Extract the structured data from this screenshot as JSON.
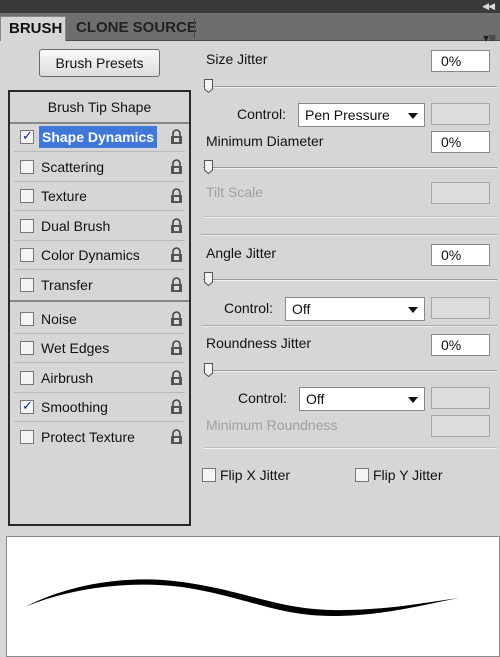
{
  "tabs": [
    {
      "label": "BRUSH"
    },
    {
      "label": "CLONE SOURCE"
    }
  ],
  "presets_button": "Brush Presets",
  "tip_shape_label": "Brush Tip Shape",
  "options": [
    {
      "label": "Shape Dynamics",
      "checked": true,
      "selected": true
    },
    {
      "label": "Scattering",
      "checked": false
    },
    {
      "label": "Texture",
      "checked": false
    },
    {
      "label": "Dual Brush",
      "checked": false
    },
    {
      "label": "Color Dynamics",
      "checked": false
    },
    {
      "label": "Transfer",
      "checked": false
    },
    {
      "label": "Noise",
      "checked": false
    },
    {
      "label": "Wet Edges",
      "checked": false
    },
    {
      "label": "Airbrush",
      "checked": false
    },
    {
      "label": "Smoothing",
      "checked": true
    },
    {
      "label": "Protect Texture",
      "checked": false
    }
  ],
  "settings": {
    "size_jitter": {
      "label": "Size Jitter",
      "value": "0%"
    },
    "size_control": {
      "label": "Control:",
      "value": "Pen Pressure"
    },
    "min_diameter": {
      "label": "Minimum Diameter",
      "value": "0%"
    },
    "tilt_scale": {
      "label": "Tilt Scale"
    },
    "angle_jitter": {
      "label": "Angle Jitter",
      "value": "0%"
    },
    "angle_control": {
      "label": "Control:",
      "value": "Off"
    },
    "roundness_jitter": {
      "label": "Roundness Jitter",
      "value": "0%"
    },
    "roundness_control": {
      "label": "Control:",
      "value": "Off"
    },
    "min_roundness": {
      "label": "Minimum Roundness"
    }
  },
  "flip_x": {
    "label": "Flip X Jitter",
    "checked": false
  },
  "flip_y": {
    "label": "Flip Y Jitter",
    "checked": false
  },
  "colors": {
    "selection": "#3f78d8",
    "tick": "#0b2a8a"
  }
}
